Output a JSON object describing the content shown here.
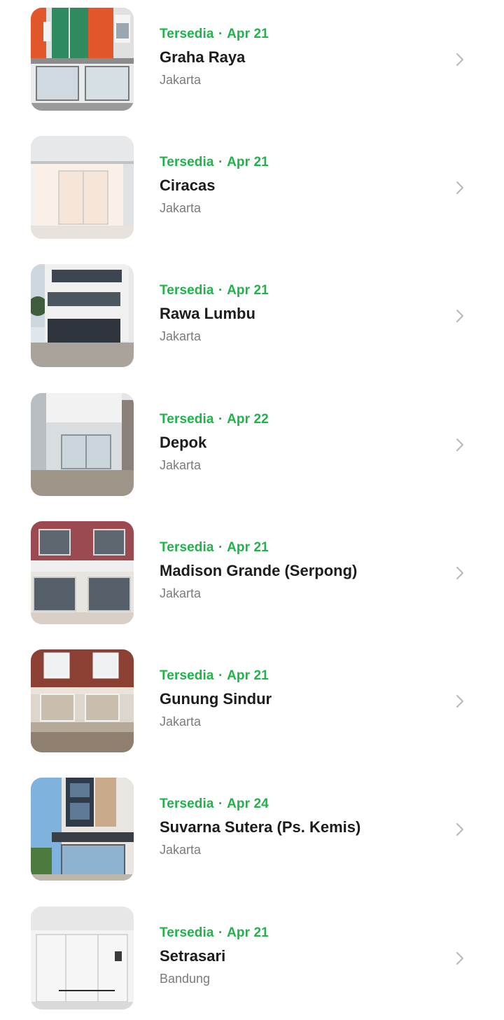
{
  "listings": [
    {
      "status": "Tersedia",
      "separator": "·",
      "date": "Apr 21",
      "name": "Graha Raya",
      "city": "Jakarta",
      "icon": "chevron-right-icon"
    },
    {
      "status": "Tersedia",
      "separator": "·",
      "date": "Apr 21",
      "name": "Ciracas",
      "city": "Jakarta",
      "icon": "chevron-right-icon"
    },
    {
      "status": "Tersedia",
      "separator": "·",
      "date": "Apr 21",
      "name": "Rawa Lumbu",
      "city": "Jakarta",
      "icon": "chevron-right-icon"
    },
    {
      "status": "Tersedia",
      "separator": "·",
      "date": "Apr 22",
      "name": "Depok",
      "city": "Jakarta",
      "icon": "chevron-right-icon"
    },
    {
      "status": "Tersedia",
      "separator": "·",
      "date": "Apr 21",
      "name": "Madison Grande (Serpong)",
      "city": "Jakarta",
      "icon": "chevron-right-icon"
    },
    {
      "status": "Tersedia",
      "separator": "·",
      "date": "Apr 21",
      "name": "Gunung Sindur",
      "city": "Jakarta",
      "icon": "chevron-right-icon"
    },
    {
      "status": "Tersedia",
      "separator": "·",
      "date": "Apr 24",
      "name": "Suvarna Sutera (Ps. Kemis)",
      "city": "Jakarta",
      "icon": "chevron-right-icon"
    },
    {
      "status": "Tersedia",
      "separator": "·",
      "date": "Apr 21",
      "name": "Setrasari",
      "city": "Bandung",
      "icon": "chevron-right-icon"
    }
  ],
  "colors": {
    "available": "#1fb34a",
    "title": "#1c1c1c",
    "subtitle": "#7b7b7b",
    "chevron": "#b8b8b8"
  }
}
